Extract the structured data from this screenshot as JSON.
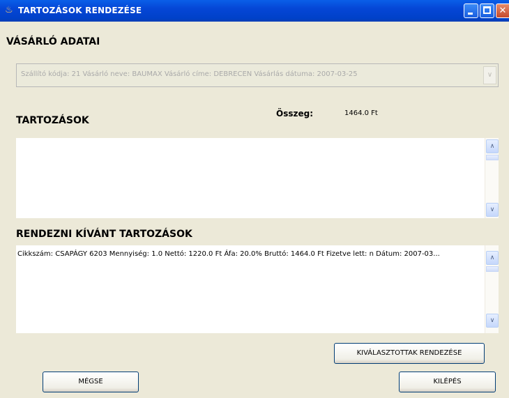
{
  "window": {
    "title": "TARTOZÁSOK RENDEZÉSE",
    "icon": "java-cup-icon",
    "controls": [
      "minimize",
      "maximize",
      "close"
    ]
  },
  "customer": {
    "heading": "VÁSÁRLÓ ADATAI",
    "selected": "Szállító kódja: 21  Vásárló neve:     BAUMAX  Vásárló címe: DEBRECEN   Vásárlás  dátuma: 2007-03-25"
  },
  "debts": {
    "heading": "TARTOZÁSOK",
    "total_label": "Összeg:",
    "total_value": "1464.0 Ft",
    "items": []
  },
  "to_settle": {
    "heading": "RENDEZNI KÍVÁNT TARTOZÁSOK",
    "items": [
      "Cikkszám:  CSAPÁGY 6203  Mennyiség: 1.0      Nettó: 1220.0 Ft     Áfa: 20.0%  Bruttó: 1464.0 Ft  Fizetve lett: n  Dátum: 2007-03..."
    ]
  },
  "buttons": {
    "settle_selected": "KIVÁLASZTOTTAK RENDEZÉSE",
    "cancel": "MÉGSE",
    "exit": "KILÉPÉS"
  },
  "colors": {
    "titlebar": "#0546d6",
    "background": "#ece9d8"
  }
}
